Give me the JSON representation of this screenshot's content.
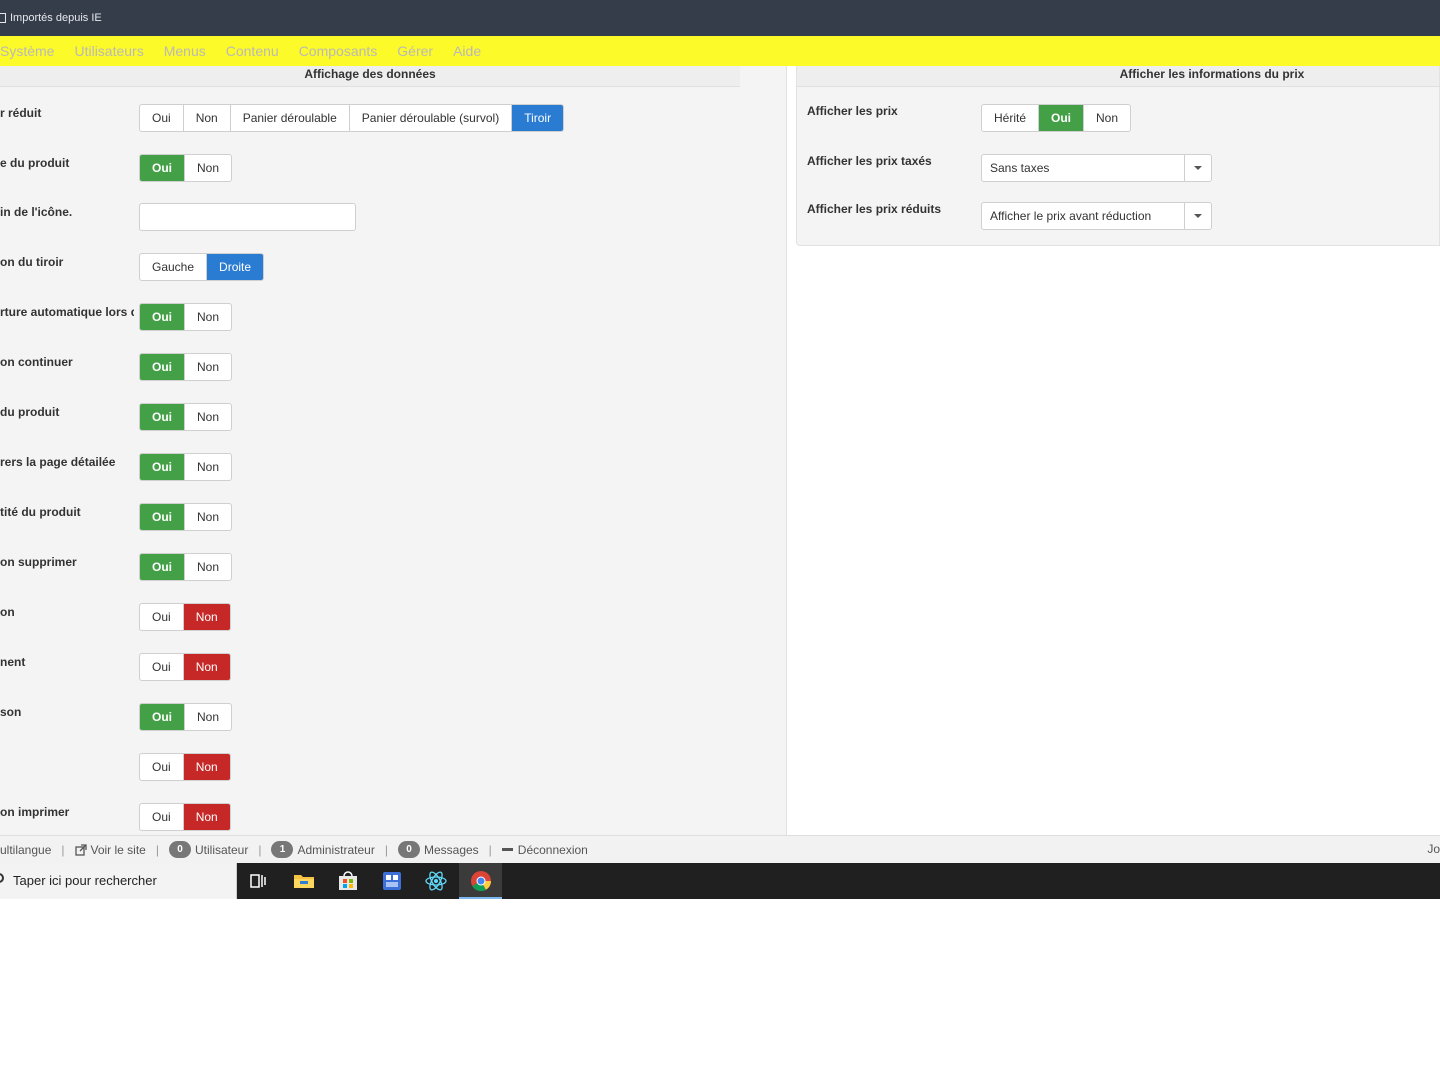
{
  "bookmarks": {
    "label": "Importés depuis IE"
  },
  "menubar": {
    "items": [
      "Système",
      "Utilisateurs",
      "Menus",
      "Contenu",
      "Composants",
      "Gérer",
      "Aide"
    ]
  },
  "left_panel": {
    "title": "Affichage des données",
    "rows": [
      {
        "label": "r réduit",
        "options": [
          "Oui",
          "Non",
          "Panier déroulable",
          "Panier déroulable (survol)",
          "Tiroir"
        ],
        "active": "Tiroir"
      },
      {
        "label": "e du produit",
        "options": [
          "Oui",
          "Non"
        ],
        "active": "Oui"
      },
      {
        "label": "in de l'icône.",
        "input_value": ""
      },
      {
        "label": "on du tiroir",
        "options": [
          "Gauche",
          "Droite"
        ],
        "active": "Droite"
      },
      {
        "label": "rture automatique lors d",
        "options": [
          "Oui",
          "Non"
        ],
        "active": "Oui"
      },
      {
        "label": "on continuer",
        "options": [
          "Oui",
          "Non"
        ],
        "active": "Oui"
      },
      {
        "label": "du produit",
        "options": [
          "Oui",
          "Non"
        ],
        "active": "Oui"
      },
      {
        "label": "rers la page détailée",
        "options": [
          "Oui",
          "Non"
        ],
        "active": "Oui"
      },
      {
        "label": "tité du produit",
        "options": [
          "Oui",
          "Non"
        ],
        "active": "Oui"
      },
      {
        "label": "on supprimer",
        "options": [
          "Oui",
          "Non"
        ],
        "active": "Oui"
      },
      {
        "label": "on",
        "options": [
          "Oui",
          "Non"
        ],
        "active": "Non"
      },
      {
        "label": "nent",
        "options": [
          "Oui",
          "Non"
        ],
        "active": "Non"
      },
      {
        "label": "son",
        "options": [
          "Oui",
          "Non"
        ],
        "active": "Oui"
      },
      {
        "label": "",
        "options": [
          "Oui",
          "Non"
        ],
        "active": "Non"
      },
      {
        "label": "on imprimer",
        "options": [
          "Oui",
          "Non"
        ],
        "active": "Non"
      }
    ]
  },
  "right_panel": {
    "title": "Afficher les informations du prix",
    "show_prices": {
      "label": "Afficher les prix",
      "options": [
        "Hérité",
        "Oui",
        "Non"
      ],
      "active": "Oui"
    },
    "show_taxed": {
      "label": "Afficher les prix taxés",
      "value": "Sans taxes"
    },
    "show_reduced": {
      "label": "Afficher les prix réduits",
      "value": "Afficher le prix avant réduction"
    }
  },
  "statusbar": {
    "multilang": "ultilangue",
    "view_site": "Voir le site",
    "users_count": "0",
    "users_label": "Utilisateur",
    "admin_count": "1",
    "admin_label": "Administrateur",
    "messages_count": "0",
    "messages_label": "Messages",
    "logout": "Déconnexion",
    "joomla_cut": "Jo"
  },
  "taskbar": {
    "search_placeholder": "Taper ici pour rechercher"
  },
  "colors": {
    "green": "#43a047",
    "red": "#c62828",
    "blue": "#2a7bd2",
    "menubar": "#fdfa2a"
  }
}
